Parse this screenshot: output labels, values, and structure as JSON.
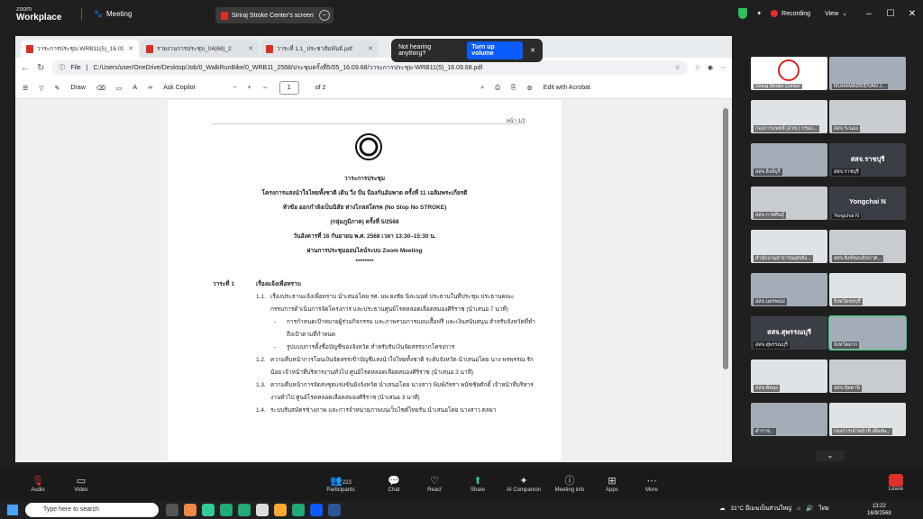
{
  "zoom": {
    "brand_small": "zoom",
    "brand": "Workplace",
    "meeting_label": "Meeting",
    "share_title": "Siriraj Stroke Center's screen",
    "recording": "Recording",
    "view": "View"
  },
  "toast": {
    "text": "Not hearing anything?",
    "button": "Turn up volume"
  },
  "browser": {
    "tabs": [
      "วาระการประชุม-WRB11(5)_16.09.68",
      "รายงานการประชุม_04(68)_2",
      "วาระที่ 1.1_ประชาสัมพันธ์.pdf"
    ],
    "url_prefix": "File",
    "url": "C:/Users/user/OneDrive/Desktop/Job/0_WalkRunBike/0_WRB11_2568/ประชุมครั้งที่5/05_16.09.68/วาระการประชุม-WRB11(5)_16.09.68.pdf"
  },
  "pdf_toolbar": {
    "draw": "Draw",
    "copilot": "Ask Copilot",
    "page": "1",
    "of": "of 2",
    "edit": "Edit with Acrobat",
    "zoom_minus": "−",
    "zoom_plus": "+"
  },
  "doc": {
    "page_label": "หน้า 1/2",
    "heading": "วาระการประชุม",
    "line1": "โครงการแสงนำใจไทยทั้งชาติ เดิน วิ่ง ปั่น ป้องกันอัมพาต ครั้งที่ 11 เฉลิมพระเกียรติ",
    "line2": "หัวข้อ ออกกำลังเป็นนิสัย ห่างไกลสโตรค (No Stop No STROKE)",
    "line3": "(กลุ่มภูมิภาค) ครั้งที่ 5/2568",
    "line4": "วันอังคารที่ 16 กันยายน พ.ศ. 2568 เวลา 13:30–15:30 น.",
    "line5": "ผ่านการประชุมออนไลน์ระบบ Zoom Meeting",
    "stars": "********",
    "agenda_no": "วาระที่ 1",
    "agenda_title": "เรื่องแจ้งเพื่อทราบ",
    "items": [
      {
        "no": "1.1.",
        "text": "เรื่องประธานแจ้งเพื่อทราบ นำเสนอโดย รศ. นพ.ยงชัย นิละนนท์ ประธานในที่ประชุม ประธานคณะกรรมการดำเนินการจัดโครงการ และประธานศูนย์โรคหลอดเลือดสมองศิริราช (นำเสนอ 7 นาที)"
      },
      {
        "no": "-",
        "text": "การกำหนดเป้าหมายผู้ร่วมกิจกรรม และภาพรวมการมอบเสื้อฟรี และเงินสนับสนุน สำหรับจังหวัดที่ทำถึงเป้าตามที่กำหนด"
      },
      {
        "no": "-",
        "text": "รูปแบบการตั้งชื่อบัญชีของจังหวัด สำหรับรับเงินจัดสรรจากโครงการ"
      },
      {
        "no": "1.2.",
        "text": "ความคืบหน้าการโอนเงินจัดสรรเข้าบัญชีแสงนำใจไทยทั้งชาติ ระดับจังหวัด นำเสนอโดย นาง พรพรรณ รักน้อย เจ้าหน้าที่บริหารงานทั่วไป ศูนย์โรคหลอดเลือดสมองศิริราช (นำเสนอ 3 นาที)"
      },
      {
        "no": "1.3.",
        "text": "ความคืบหน้าการจัดส่งชุดแข่งขันยังจังหวัด นำเสนอโดย นางสาว พิมพ์ภัทรา พนัชชัยศักดิ์ เจ้าหน้าที่บริหารงานทั่วไป ศูนย์โรคหลอดเลือดสมองศิริราช (นำเสนอ 3 นาที)"
      },
      {
        "no": "1.4.",
        "text": "ระบบรับสมัครช่างภาพ และการจำหน่ายภาพบนเว็บไซต์ไทยรัน นำเสนอโดย นางสาว ตลยา"
      }
    ]
  },
  "participants": [
    {
      "name": "Siriraj Stroke Center",
      "kind": "logo"
    },
    {
      "name": "MUHAMADRIDVAN J...",
      "kind": "cam"
    },
    {
      "name": "กองการแพทย์ (สวท.) กรมแ...",
      "kind": "cam"
    },
    {
      "name": "สสจ.ระนอง",
      "kind": "cam"
    },
    {
      "name": "สสจ.สิงห์บุรี",
      "kind": "cam"
    },
    {
      "name": "สสจ.ราชบุรี",
      "kind": "text",
      "big": "สสจ.ราชบุรี"
    },
    {
      "name": "สสจ.กาฬสินธุ์",
      "kind": "cam"
    },
    {
      "name": "Yongchai N",
      "kind": "text",
      "big": "Yongchai N"
    },
    {
      "name": "สำนักงานสาธารณสุขจัง...",
      "kind": "cam"
    },
    {
      "name": "สสจ.สิงห์ชอบธิปกาศ...",
      "kind": "cam"
    },
    {
      "name": "สสจ.นครพนม",
      "kind": "cam"
    },
    {
      "name": "จังหวัดชลบุรี",
      "kind": "cam"
    },
    {
      "name": "สสจ.สุพรรณบุรี",
      "kind": "text",
      "big": "สสจ.สุพรรณบุรี"
    },
    {
      "name": "จังหวัดตาก",
      "kind": "cam"
    },
    {
      "name": "สสจ.พัทลุง",
      "kind": "cam"
    },
    {
      "name": "สสจ.ปัตตานี",
      "kind": "cam"
    },
    {
      "name": "ตำรวจ...",
      "kind": "cam"
    },
    {
      "name": "กองการเจ้าหน้าที่ เพื่อสพ...",
      "kind": "cam"
    }
  ],
  "toolbar": {
    "audio": "Audio",
    "video": "Video",
    "participants": "Participants",
    "participants_count": "223",
    "chat": "Chat",
    "react": "React",
    "share": "Share",
    "ai": "AI Companion",
    "info": "Meeting info",
    "apps": "Apps",
    "more": "More",
    "leave": "Leave"
  },
  "taskbar": {
    "search": "Type here to search",
    "weather": "31°C มีเมฆเป็นส่วนใหญ่",
    "lang": "ไทย",
    "time": "13:22",
    "date": "16/9/2568"
  }
}
